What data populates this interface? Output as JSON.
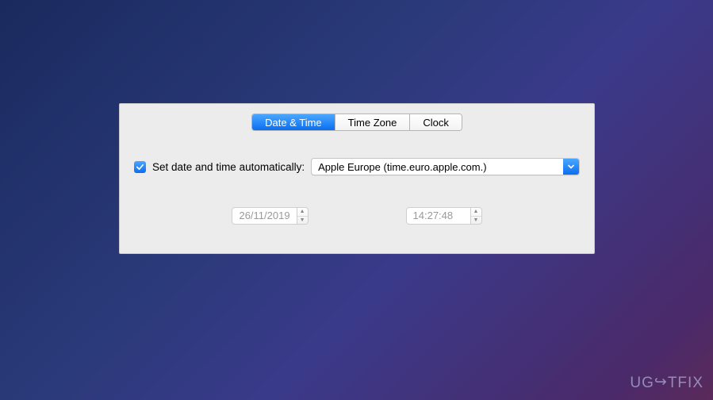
{
  "tabs": {
    "date_time": "Date & Time",
    "time_zone": "Time Zone",
    "clock": "Clock"
  },
  "auto": {
    "label": "Set date and time automatically:",
    "checked": true,
    "server": "Apple Europe (time.euro.apple.com.)"
  },
  "date_field": {
    "value": "26/11/2019"
  },
  "time_field": {
    "value": "14:27:48"
  },
  "watermark": {
    "prefix": "UG",
    "suffix": "TFIX"
  }
}
